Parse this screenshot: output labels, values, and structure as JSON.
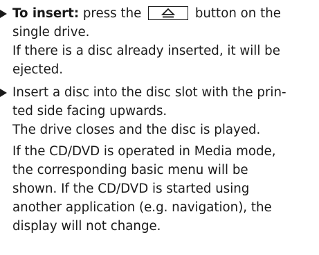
{
  "steps": [
    {
      "lead_bold": "To insert:",
      "lead_text_before_key": " press the ",
      "key_icon": "eject-icon",
      "lead_text_after_key": " button on the",
      "lines": [
        "single drive.",
        "If there is a disc already inserted, it will be",
        "ejected."
      ]
    },
    {
      "lines": [
        "Insert a disc into the disc slot with the prin-",
        "ted side facing upwards.",
        "The drive closes and the disc is played."
      ],
      "paragraph_lines": [
        "If the CD/DVD is operated in Media mode,",
        "the corresponding basic menu will be",
        "shown. If the CD/DVD is started using",
        "another application (e.g. navigation), the",
        "display will not change."
      ]
    }
  ]
}
